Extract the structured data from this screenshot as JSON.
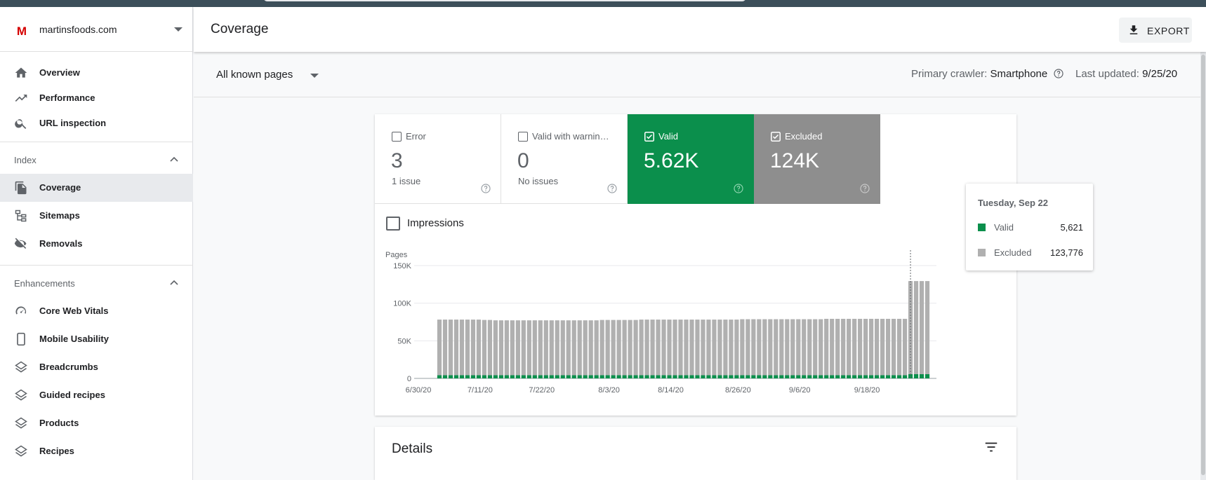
{
  "property": {
    "name": "martinsfoods.com",
    "logo_letter": "M"
  },
  "sidebar": {
    "top_items": [
      {
        "label": "Overview",
        "icon": "home-icon"
      },
      {
        "label": "Performance",
        "icon": "trending-up-icon"
      },
      {
        "label": "URL inspection",
        "icon": "search-icon"
      }
    ],
    "index_section": {
      "label": "Index"
    },
    "index_items": [
      {
        "label": "Coverage",
        "icon": "coverage-icon",
        "active": true
      },
      {
        "label": "Sitemaps",
        "icon": "sitemap-icon"
      },
      {
        "label": "Removals",
        "icon": "removals-icon"
      }
    ],
    "enhancements_section": {
      "label": "Enhancements"
    },
    "enhancement_items": [
      {
        "label": "Core Web Vitals",
        "icon": "gauge-icon"
      },
      {
        "label": "Mobile Usability",
        "icon": "phone-icon"
      },
      {
        "label": "Breadcrumbs",
        "icon": "layers-icon"
      },
      {
        "label": "Guided recipes",
        "icon": "layers-icon"
      },
      {
        "label": "Products",
        "icon": "layers-icon"
      },
      {
        "label": "Recipes",
        "icon": "layers-icon"
      }
    ]
  },
  "header": {
    "title": "Coverage",
    "export_label": "EXPORT"
  },
  "filter": {
    "pages_label": "All known pages",
    "crawler_prefix": "Primary crawler:",
    "crawler_value": "Smartphone",
    "updated_prefix": "Last updated:",
    "updated_value": "9/25/20"
  },
  "tiles": [
    {
      "label": "Error",
      "value": "3",
      "sub": "1 issue",
      "checked": false
    },
    {
      "label": "Valid with warnin…",
      "value": "0",
      "sub": "No issues",
      "checked": false
    },
    {
      "label": "Valid",
      "value": "5.62K",
      "sub": "",
      "checked": true
    },
    {
      "label": "Excluded",
      "value": "124K",
      "sub": "",
      "checked": true
    }
  ],
  "impressions_label": "Impressions",
  "colors": {
    "valid": "#0b8f4c",
    "excluded": "#b0b0b0",
    "excluded_tile": "#8e8e8e"
  },
  "tooltip": {
    "date": "Tuesday, Sep 22",
    "rows": [
      {
        "name": "Valid",
        "value": "5,621"
      },
      {
        "name": "Excluded",
        "value": "123,776"
      }
    ]
  },
  "details": {
    "title": "Details"
  },
  "chart_data": {
    "type": "bar",
    "stacked": true,
    "ylabel": "Pages",
    "ylim": [
      0,
      150000
    ],
    "y_ticks": [
      0,
      50000,
      100000,
      150000
    ],
    "y_tick_labels": [
      "0",
      "50K",
      "100K",
      "150K"
    ],
    "x_tick_labels": [
      "6/30/20",
      "7/11/20",
      "7/22/20",
      "8/3/20",
      "8/14/20",
      "8/26/20",
      "9/6/20",
      "9/18/20"
    ],
    "x_tick_indices": [
      0,
      11,
      22,
      34,
      45,
      57,
      68,
      80
    ],
    "categories_start": "6/30/20",
    "categories_end": "9/25/20",
    "highlight_index": 84,
    "series": [
      {
        "name": "Valid",
        "values": [
          4200,
          4200,
          4200,
          4200,
          4200,
          4200,
          4200,
          4200,
          4200,
          4200,
          4200,
          4200,
          4200,
          4200,
          4200,
          4200,
          4200,
          4200,
          4200,
          4200,
          4200,
          4200,
          4200,
          4200,
          4200,
          4200,
          4200,
          4200,
          4200,
          4200,
          4200,
          4200,
          4200,
          4200,
          4200,
          4200,
          4200,
          4200,
          4200,
          4200,
          4200,
          4200,
          4200,
          4200,
          4200,
          4200,
          4200,
          4200,
          4200,
          4200,
          4200,
          4200,
          4200,
          4200,
          4200,
          4200,
          4200,
          4200,
          4200,
          4200,
          4200,
          4200,
          4200,
          4200,
          4200,
          4200,
          4200,
          4200,
          4200,
          4200,
          4200,
          4200,
          4200,
          4200,
          4200,
          4200,
          4200,
          4200,
          4200,
          4200,
          4200,
          4200,
          4200,
          4200,
          5621,
          5600,
          5600,
          5600
        ]
      },
      {
        "name": "Excluded",
        "values": [
          74000,
          74000,
          74000,
          74000,
          74000,
          74000,
          74000,
          74000,
          73500,
          73500,
          73000,
          73000,
          73000,
          73000,
          73000,
          73000,
          73000,
          73000,
          73000,
          73000,
          73000,
          73000,
          73000,
          73000,
          73000,
          73000,
          73000,
          73000,
          73000,
          73500,
          73500,
          73500,
          73500,
          73500,
          73500,
          73500,
          74000,
          74000,
          74000,
          74000,
          74000,
          74000,
          74000,
          74000,
          74000,
          74000,
          74000,
          74000,
          74000,
          74000,
          74000,
          74000,
          74000,
          74000,
          74500,
          74500,
          74500,
          74500,
          74500,
          74500,
          74500,
          74500,
          74500,
          74500,
          74500,
          74500,
          74500,
          74500,
          74500,
          75000,
          75000,
          75000,
          75000,
          75000,
          75000,
          75000,
          75000,
          75000,
          75000,
          75000,
          75000,
          75000,
          75000,
          75000,
          123776,
          123800,
          123800,
          123800
        ]
      }
    ]
  }
}
